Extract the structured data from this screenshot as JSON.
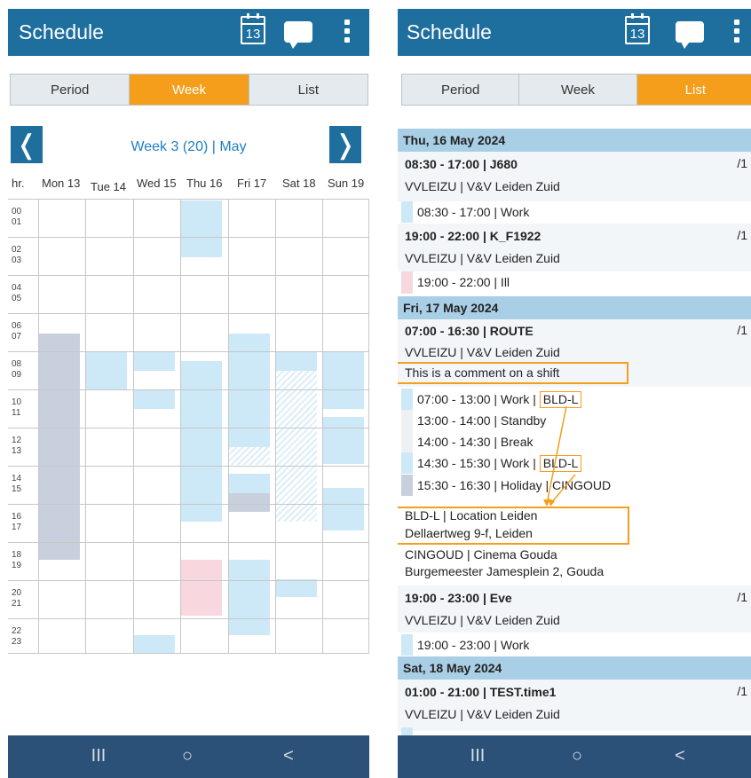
{
  "left_screen": {
    "title": "Schedule",
    "calendar_icon_number": "13",
    "tabs": [
      "Period",
      "Week",
      "List"
    ],
    "active_tab": "Week",
    "week_label": "Week 3 (20) | May",
    "prev_symbol": "❬",
    "next_symbol": "❭",
    "hour_header": "hr.",
    "days": [
      "Mon 13",
      "Tue 14",
      "Wed 15",
      "Thu 16",
      "Fri 17",
      "Sat 18",
      "Sun 19"
    ],
    "hours": [
      [
        "00",
        "01"
      ],
      [
        "02",
        "03"
      ],
      [
        "04",
        "05"
      ],
      [
        "06",
        "07"
      ],
      [
        "08",
        "09"
      ],
      [
        "10",
        "11"
      ],
      [
        "12",
        "13"
      ],
      [
        "14",
        "15"
      ],
      [
        "16",
        "17"
      ],
      [
        "18",
        "19"
      ],
      [
        "20",
        "21"
      ],
      [
        "22",
        "23"
      ]
    ]
  },
  "right_screen": {
    "title": "Schedule",
    "calendar_icon_number": "13",
    "tabs": [
      "Period",
      "Week",
      "List"
    ],
    "active_tab": "List",
    "day_headers": {
      "thu": "Thu, 16 May 2024",
      "fri": "Fri, 17 May 2024",
      "sat": "Sat, 18 May 2024"
    },
    "shifts": {
      "j680": {
        "title": "08:30 - 17:00 | J680",
        "location": "VVLEIZU | V&V Leiden Zuid",
        "count": "/1",
        "line1": "08:30 - 17:00 | Work"
      },
      "kf1922": {
        "title": "19:00 - 22:00 | K_F1922",
        "location": "VVLEIZU | V&V Leiden Zuid",
        "count": "/1",
        "line1": "19:00 - 22:00 | Ill"
      },
      "route": {
        "title": "07:00 - 16:30 | ROUTE",
        "location": "VVLEIZU | V&V Leiden Zuid",
        "count": "/1",
        "comment": "This is a comment on a shift",
        "line1_prefix": "07:00 - 13:00 | Work |",
        "line1_tag": "BLD-L",
        "line2": "13:00 - 14:00 | Standby",
        "line3": "14:00 - 14:30 | Break",
        "line4_prefix": "14:30 - 15:30 | Work |",
        "line4_tag": "BLD-L",
        "line5": "15:30 - 16:30 | Holiday | CINGOUD",
        "loc1_name": "BLD-L | Location Leiden",
        "loc1_addr": "Dellaertweg 9-f, Leiden",
        "loc2_name": "CINGOUD | Cinema Gouda",
        "loc2_addr": "Burgemeester Jamesplein 2, Gouda"
      },
      "eve": {
        "title": "19:00 - 23:00 | Eve",
        "location": "VVLEIZU | V&V Leiden Zuid",
        "count": "/1",
        "line1": "19:00 - 23:00 | Work"
      },
      "test": {
        "title": "01:00 - 21:00 | TEST.time1",
        "location": "VVLEIZU | V&V Leiden Zuid",
        "count": "/1"
      }
    }
  },
  "navbar": {
    "recents": "III",
    "home": "○",
    "back": "<"
  },
  "colors": {
    "app_bar": "#1e6e9e",
    "active_tab": "#f59e1b",
    "shift_blue": "#cde8f6",
    "shift_grey": "#c9d0dd",
    "shift_pink": "#f8d7df",
    "day_header": "#a9cfe6",
    "nav_bar": "#2b5178",
    "annotation": "#f59e1b"
  }
}
